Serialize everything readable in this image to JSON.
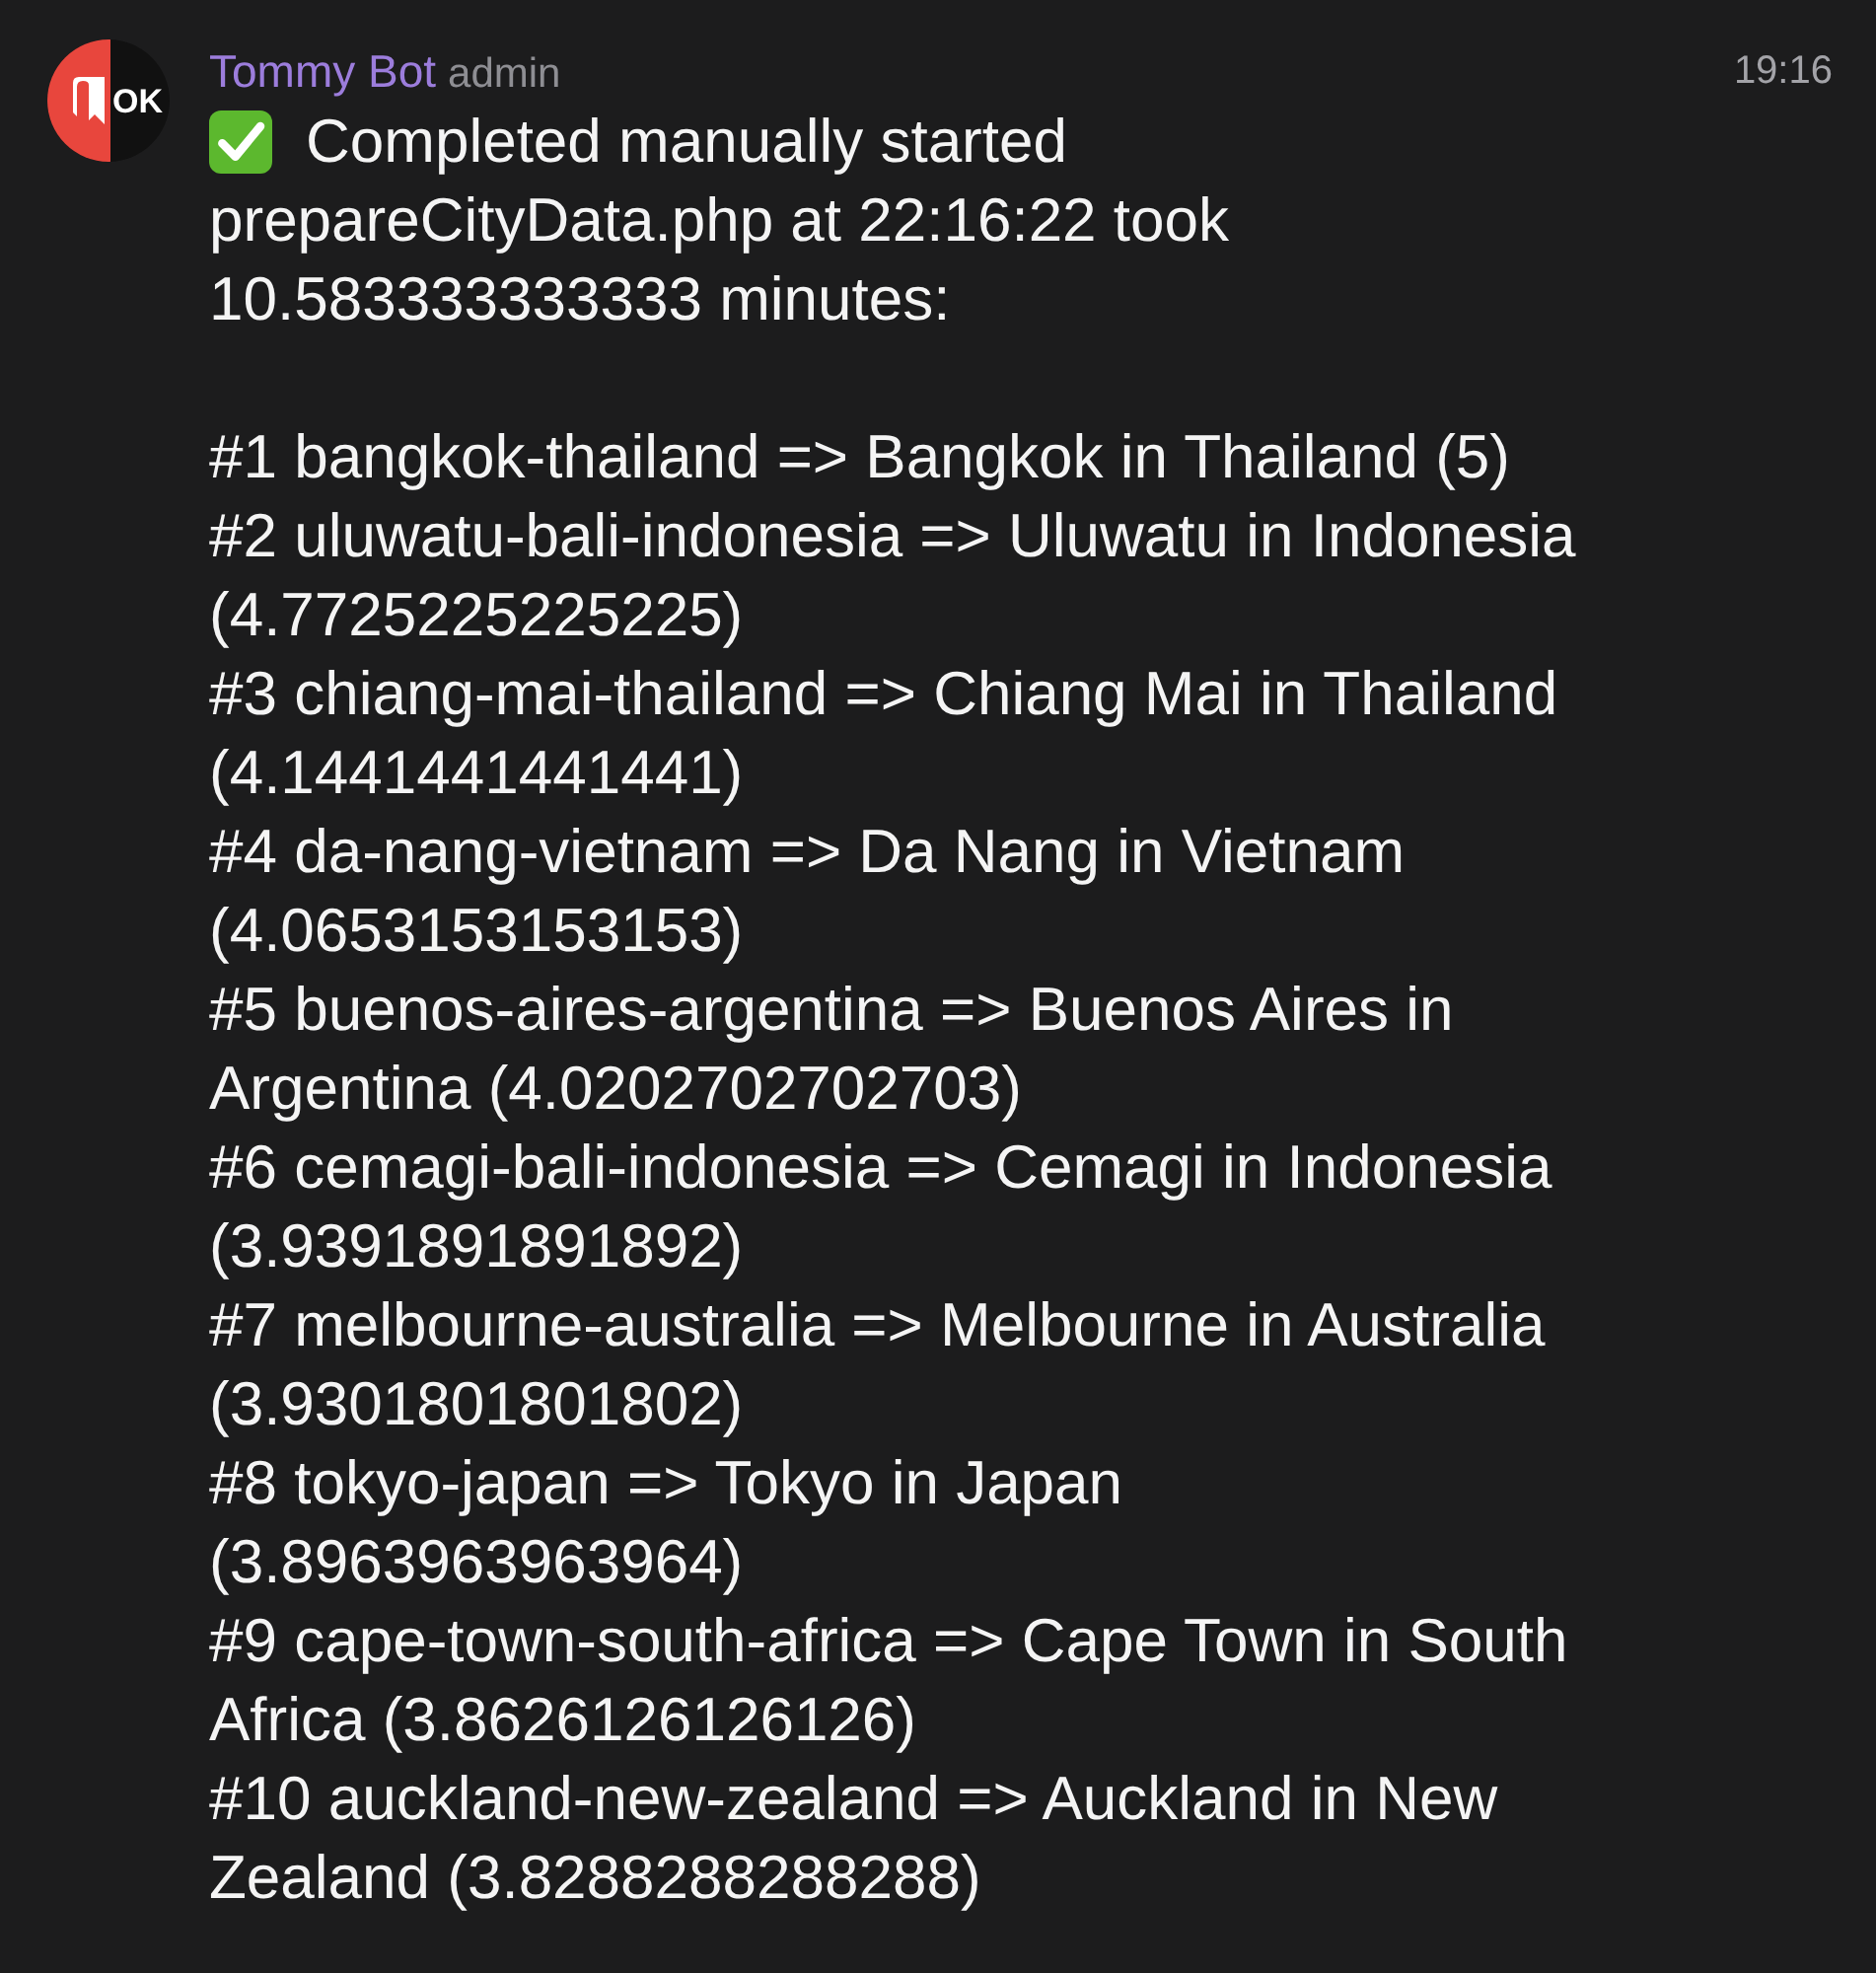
{
  "message": {
    "sender": {
      "name": "Tommy Bot",
      "role": "admin",
      "avatar_text": "OK"
    },
    "time": "19:16",
    "header_lines": [
      "Completed manually started",
      "prepareCityData.php at 22:16:22 took 10.583333333333 minutes:"
    ],
    "entries": [
      "#1 bangkok-thailand => Bangkok in Thailand (5)",
      "#2 uluwatu-bali-indonesia => Uluwatu in Indonesia (4.7725225225225)",
      "#3 chiang-mai-thailand => Chiang Mai in Thailand (4.1441441441441)",
      "#4 da-nang-vietnam => Da Nang in Vietnam (4.0653153153153)",
      "#5 buenos-aires-argentina => Buenos Aires in Argentina (4.0202702702703)",
      "#6 cemagi-bali-indonesia => Cemagi in Indonesia (3.9391891891892)",
      "#7 melbourne-australia => Melbourne in Australia (3.9301801801802)",
      "#8 tokyo-japan => Tokyo in Japan (3.8963963963964)",
      "#9 cape-town-south-africa => Cape Town in South Africa (3.8626126126126)",
      "#10 auckland-new-zealand => Auckland in New Zealand (3.8288288288288)"
    ]
  }
}
